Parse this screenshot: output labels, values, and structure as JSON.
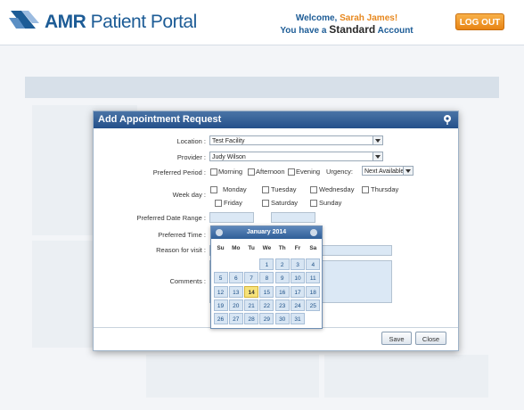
{
  "header": {
    "brand_bold": "AMR",
    "brand_rest": "Patient Portal",
    "welcome_prefix": "Welcome,",
    "user_name": "Sarah James!",
    "account_prefix": "You have a",
    "account_type": "Standard",
    "account_suffix": "Account",
    "logout_label": "LOG OUT"
  },
  "dialog": {
    "title": "Add Appointment Request",
    "location_label": "Location :",
    "location_value": "Test Facility",
    "provider_label": "Provider :",
    "provider_value": "Judy Wilson",
    "period_label": "Preferred Period :",
    "period_options": [
      "Morning",
      "Afternoon",
      "Evening"
    ],
    "urgency_label": "Urgency:",
    "urgency_value": "Next Available",
    "weekday_label": "Week day :",
    "weekdays_row1": [
      "Monday",
      "Tuesday",
      "Wednesday",
      "Thursday"
    ],
    "weekdays_row2": [
      "Friday",
      "Saturday",
      "Sunday"
    ],
    "date_range_label": "Preferred Date Range :",
    "time_label": "Preferred Time :",
    "reason_label": "Reason for visit :",
    "comments_label": "Comments :",
    "save_label": "Save",
    "close_label": "Close"
  },
  "calendar": {
    "month": "January 2014",
    "dow": [
      "Su",
      "Mo",
      "Tu",
      "We",
      "Th",
      "Fr",
      "Sa"
    ],
    "first_weekday": 3,
    "days_in_month": 31,
    "today": 14
  },
  "colors": {
    "brand": "#1d5c96",
    "accent": "#e7881f",
    "title_bar": "#24508a"
  }
}
